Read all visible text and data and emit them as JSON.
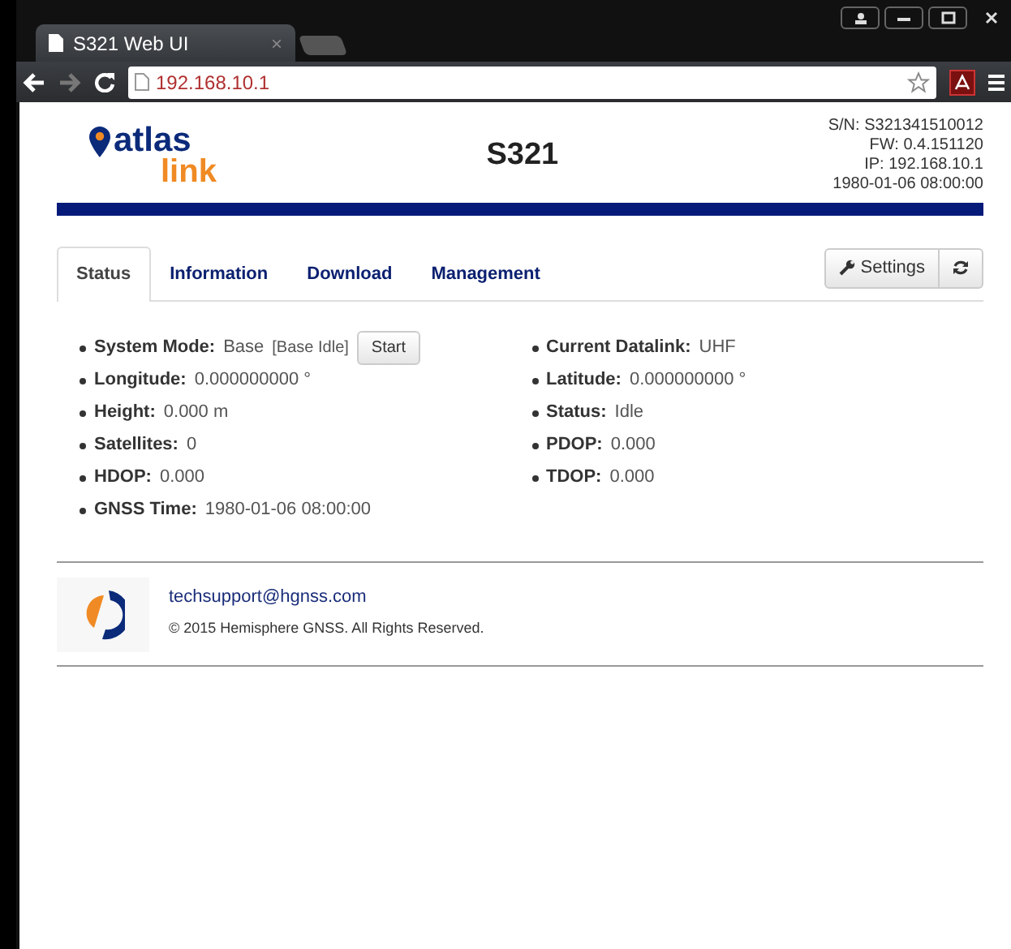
{
  "browser": {
    "tab_title": "S321 Web UI",
    "tab_close": "×",
    "url": "192.168.10.1"
  },
  "header": {
    "logo_top": "atlas",
    "logo_bottom": "link",
    "title": "S321",
    "info": [
      "S/N: S321341510012",
      "FW: 0.4.151120",
      "IP: 192.168.10.1",
      "1980-01-06 08:00:00"
    ]
  },
  "tabs": [
    {
      "label": "Status",
      "selected": true
    },
    {
      "label": "Information",
      "selected": false
    },
    {
      "label": "Download",
      "selected": false
    },
    {
      "label": "Management",
      "selected": false
    }
  ],
  "settings_button": "Settings",
  "status": {
    "left": [
      {
        "label": "System Mode:",
        "value": "Base",
        "note": "[Base Idle]",
        "button": "Start"
      },
      {
        "label": "Longitude:",
        "value": "0.000000000 °"
      },
      {
        "label": "Height:",
        "value": "0.000 m"
      },
      {
        "label": "Satellites:",
        "value": "0"
      },
      {
        "label": "HDOP:",
        "value": "0.000"
      },
      {
        "label": "GNSS Time:",
        "value": "1980-01-06 08:00:00"
      }
    ],
    "right": [
      {
        "label": "Current Datalink:",
        "value": "UHF"
      },
      {
        "label": "Latitude:",
        "value": "0.000000000 °"
      },
      {
        "label": "Status:",
        "value": "Idle"
      },
      {
        "label": "PDOP:",
        "value": "0.000"
      },
      {
        "label": "TDOP:",
        "value": "0.000"
      }
    ]
  },
  "footer": {
    "email": "techsupport@hgnss.com",
    "copyright": "© 2015 Hemisphere GNSS. All Rights Reserved."
  }
}
